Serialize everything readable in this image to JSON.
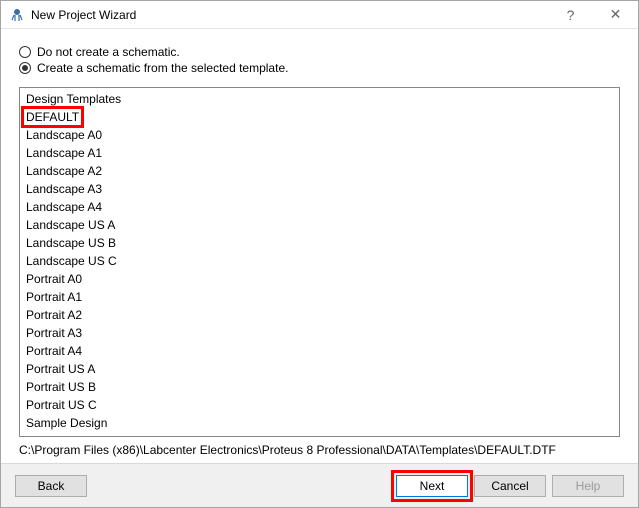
{
  "title": "New Project Wizard",
  "radios": {
    "noSchematic": "Do not create a schematic.",
    "fromTemplate": "Create a schematic from the selected template."
  },
  "listHeader": "Design Templates",
  "templates": [
    "DEFAULT",
    "Landscape A0",
    "Landscape A1",
    "Landscape A2",
    "Landscape A3",
    "Landscape A4",
    "Landscape US A",
    "Landscape US B",
    "Landscape US C",
    "Portrait A0",
    "Portrait A1",
    "Portrait A2",
    "Portrait A3",
    "Portrait A4",
    "Portrait US A",
    "Portrait US B",
    "Portrait US C",
    "Sample Design"
  ],
  "selectedTemplateIndex": 0,
  "path": "C:\\Program Files (x86)\\Labcenter Electronics\\Proteus 8 Professional\\DATA\\Templates\\DEFAULT.DTF",
  "buttons": {
    "back": "Back",
    "next": "Next",
    "cancel": "Cancel",
    "help": "Help"
  },
  "titlebar": {
    "helpGlyph": "?",
    "closeGlyph": "✕"
  }
}
